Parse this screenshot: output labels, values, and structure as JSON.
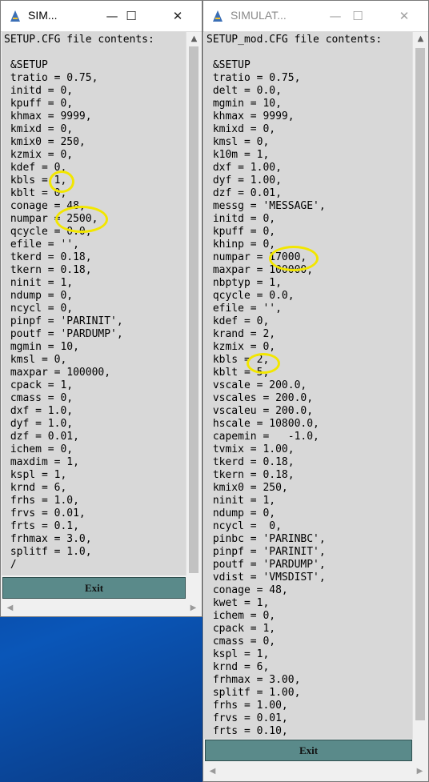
{
  "desktop": {
    "background": "#0b3a8c"
  },
  "highlight_color": "#f2e600",
  "left_window": {
    "title": "SIM...",
    "controls": {
      "minimize": "—",
      "maximize": "☐",
      "close": "✕"
    },
    "lines": [
      "SETUP.CFG file contents:",
      "",
      " &SETUP",
      " tratio = 0.75,",
      " initd = 0,",
      " kpuff = 0,",
      " khmax = 9999,",
      " kmixd = 0,",
      " kmix0 = 250,",
      " kzmix = 0,",
      " kdef = 0,",
      " kbls = 1,",
      " kblt = 0,",
      " conage = 48,",
      " numpar = 2500,",
      " qcycle = 0.0,",
      " efile = '',",
      " tkerd = 0.18,",
      " tkern = 0.18,",
      " ninit = 1,",
      " ndump = 0,",
      " ncycl = 0,",
      " pinpf = 'PARINIT',",
      " poutf = 'PARDUMP',",
      " mgmin = 10,",
      " kmsl = 0,",
      " maxpar = 100000,",
      " cpack = 1,",
      " cmass = 0,",
      " dxf = 1.0,",
      " dyf = 1.0,",
      " dzf = 0.01,",
      " ichem = 0,",
      " maxdim = 1,",
      " kspl = 1,",
      " krnd = 6,",
      " frhs = 1.0,",
      " frvs = 0.01,",
      " frts = 0.1,",
      " frhmax = 3.0,",
      " splitf = 1.0,",
      " /"
    ],
    "exit_label": "Exit"
  },
  "right_window": {
    "title": "SIMULAT...",
    "controls": {
      "minimize": "—",
      "maximize": "☐",
      "close": "✕"
    },
    "lines": [
      "SETUP_mod.CFG file contents:",
      "",
      " &SETUP",
      " tratio = 0.75,",
      " delt = 0.0,",
      " mgmin = 10,",
      " khmax = 9999,",
      " kmixd = 0,",
      " kmsl = 0,",
      " k10m = 1,",
      " dxf = 1.00,",
      " dyf = 1.00,",
      " dzf = 0.01,",
      " messg = 'MESSAGE',",
      " initd = 0,",
      " kpuff = 0,",
      " khinp = 0,",
      " numpar = 17000,",
      " maxpar = 100000,",
      " nbptyp = 1,",
      " qcycle = 0.0,",
      " efile = '',",
      " kdef = 0,",
      " krand = 2,",
      " kzmix = 0,",
      " kbls = 2,",
      " kblt = 5,",
      " vscale = 200.0,",
      " vscales = 200.0,",
      " vscaleu = 200.0,",
      " hscale = 10800.0,",
      " capemin =   -1.0,",
      " tvmix = 1.00,",
      " tkerd = 0.18,",
      " tkern = 0.18,",
      " kmix0 = 250,",
      " ninit = 1,",
      " ndump = 0,",
      " ncycl =  0,",
      " pinbc = 'PARINBC',",
      " pinpf = 'PARINIT',",
      " poutf = 'PARDUMP',",
      " vdist = 'VMSDIST',",
      " conage = 48,",
      " kwet = 1,",
      " ichem = 0,",
      " cpack = 1,",
      " cmass = 0,",
      " kspl = 1,",
      " krnd = 6,",
      " frhmax = 3.00,",
      " splitf = 1.00,",
      " frhs = 1.00,",
      " frvs = 0.01,",
      " frts = 0.10,"
    ],
    "exit_label": "Exit"
  }
}
